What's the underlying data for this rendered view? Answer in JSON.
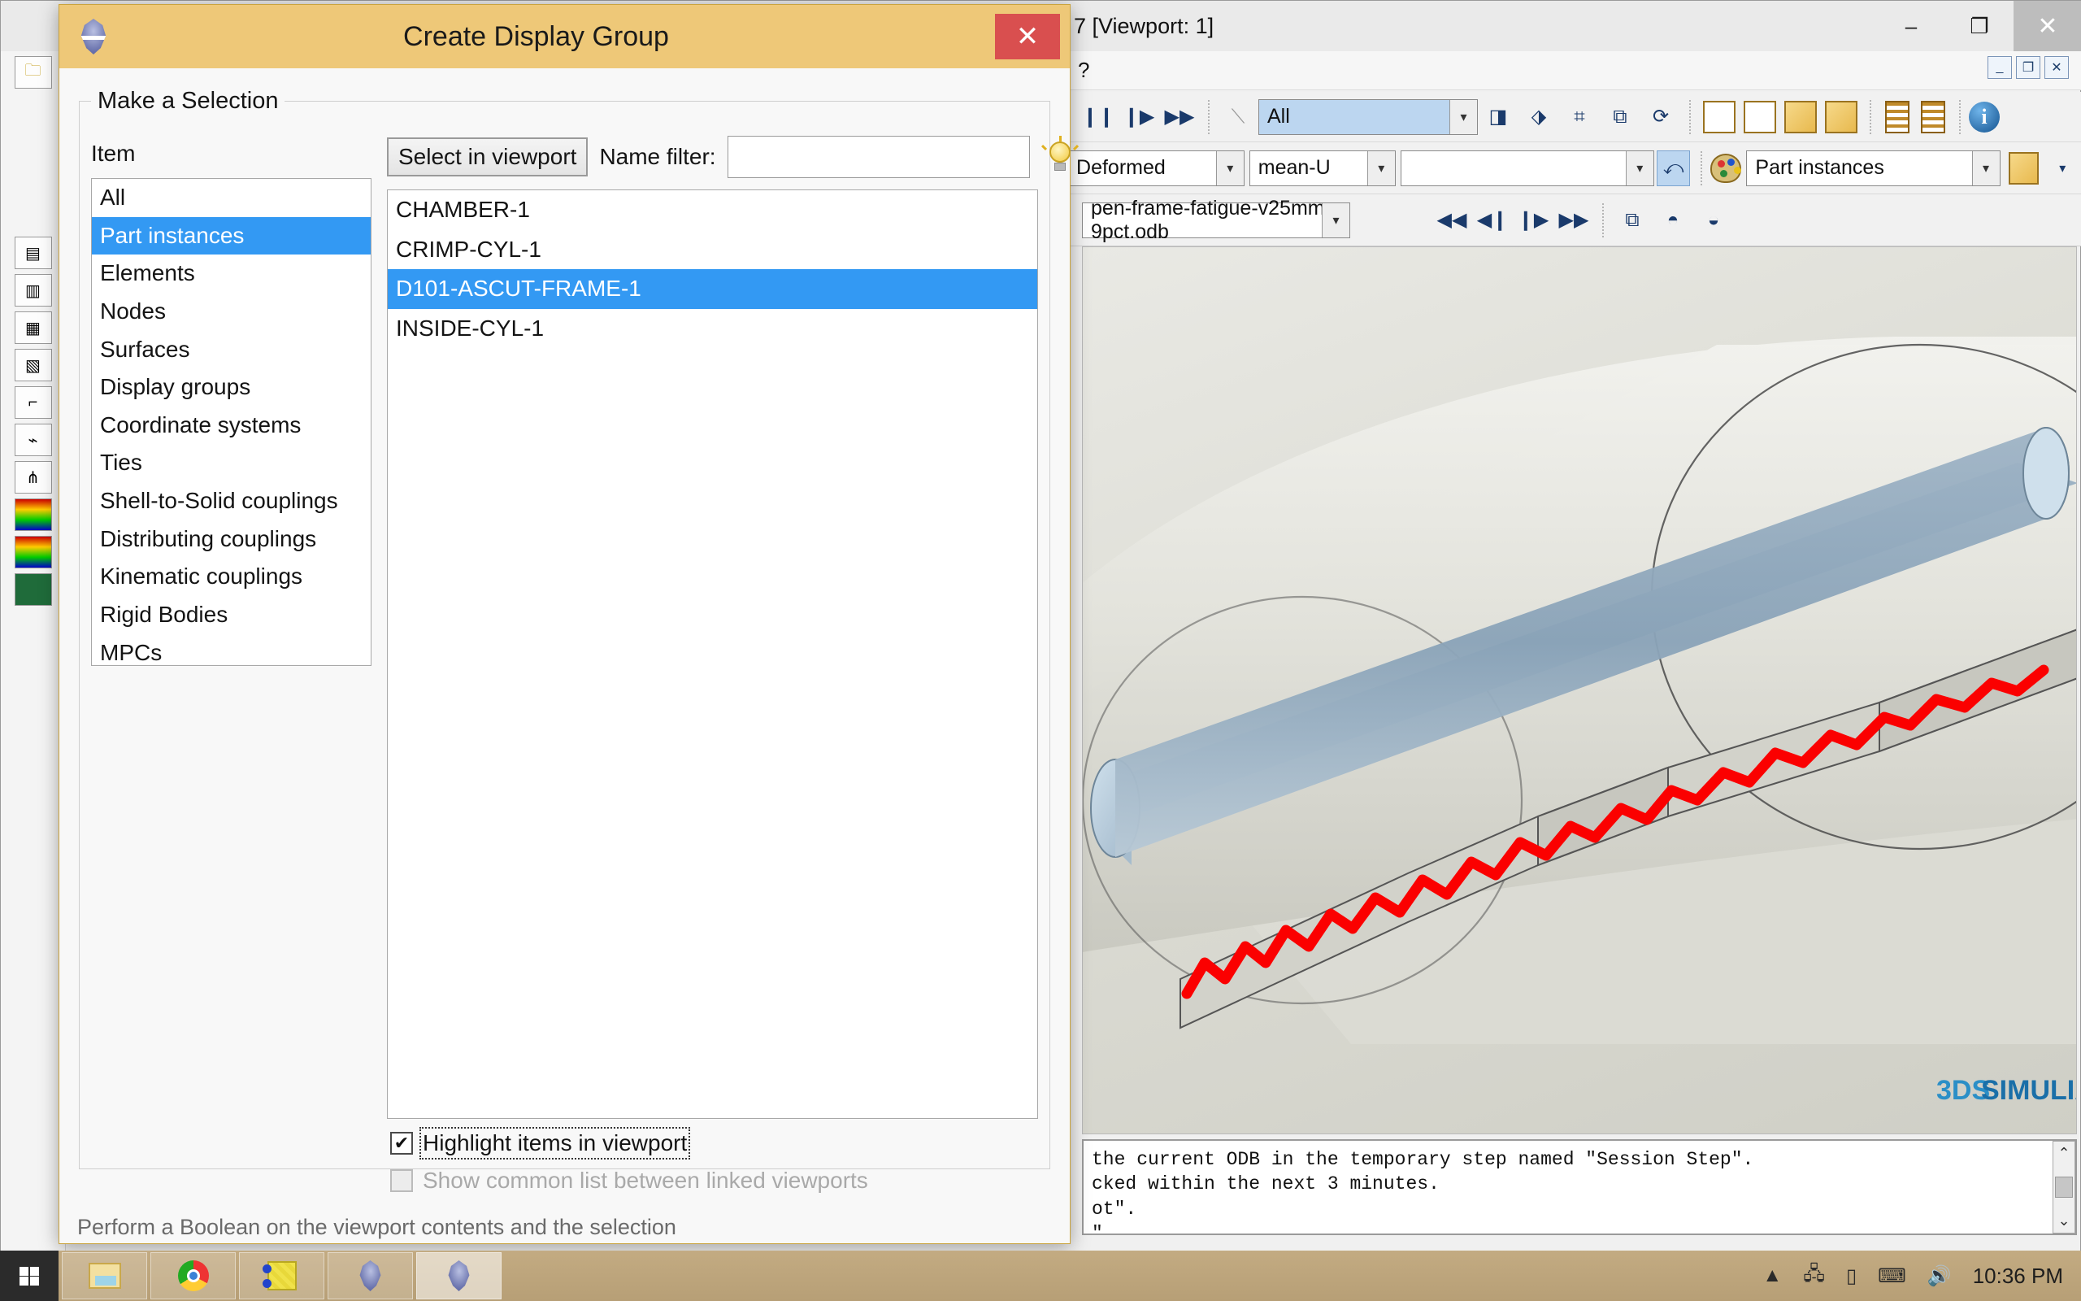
{
  "window": {
    "title": "7 [Viewport: 1]",
    "minimize_label": "–",
    "restore_label": "❐",
    "close_label": "✕",
    "menu_help": "?",
    "mdi_minimize": "_",
    "mdi_restore": "❐",
    "mdi_close": "✕"
  },
  "toolbar": {
    "selection_combo": "All",
    "plot_state_combo": "Deformed",
    "field_output_combo": "mean-U",
    "empty_combo": "",
    "display_group_combo": "Part instances",
    "odb_file": "pen-frame-fatigue-v25mm-9pct.odb",
    "icons": {
      "pause": "pause-icon",
      "step_forward": "step-forward-icon",
      "last_frame": "last-frame-icon",
      "arrow_select": "arrow-select-icon",
      "first_frame": "first-frame-icon",
      "prev_frame": "previous-frame-icon",
      "next_frame": "next-frame-icon",
      "end_frame": "end-frame-icon",
      "refresh": "refresh-icon",
      "palette": "color-palette-icon",
      "info": "info-icon",
      "camera": "camera-icon"
    }
  },
  "dialog": {
    "title": "Create Display Group",
    "close_label": "✕",
    "group_legend": "Make a Selection",
    "item_label": "Item",
    "items": [
      "All",
      "Part instances",
      "Elements",
      "Nodes",
      "Surfaces",
      "Display groups",
      "Coordinate systems",
      "Ties",
      "Shell-to-Solid couplings",
      "Distributing couplings",
      "Kinematic couplings",
      "Rigid Bodies",
      "MPCs"
    ],
    "selected_item": "Part instances",
    "select_in_viewport_button": "Select in viewport",
    "name_filter_label": "Name filter:",
    "name_filter_value": "",
    "name_filter_placeholder": "",
    "bulb_icon": "lightbulb-icon",
    "instances": [
      "CHAMBER-1",
      "CRIMP-CYL-1",
      "D101-ASCUT-FRAME-1",
      "INSIDE-CYL-1"
    ],
    "selected_instance": "D101-ASCUT-FRAME-1",
    "highlight_checkbox_label": "Highlight items in viewport",
    "highlight_checkbox_checked": true,
    "highlight_checkbox_mark": "✔",
    "common_list_checkbox_label": "Show common list between linked viewports",
    "common_list_checkbox_checked": false,
    "common_list_checkbox_disabled": true,
    "status_text": "Perform a Boolean on the viewport contents and the selection"
  },
  "viewport": {
    "branding": "SIMULIA",
    "branding_prefix": "3DS"
  },
  "console": {
    "lines": [
      "the current ODB in the temporary step named \"Session Step\".",
      "cked within the next 3 minutes.",
      "ot\".",
      "\".",
      "."
    ],
    "scroll_up": "⌃",
    "scroll_down": "⌄"
  },
  "taskbar": {
    "start_label": "start-button",
    "items": [
      "file-explorer-icon",
      "chrome-icon",
      "notes-icon",
      "abaqus-icon",
      "abaqus-active-icon"
    ],
    "tray": [
      "show-hidden-icon",
      "network-icon",
      "battery-icon",
      "keyboard-icon",
      "volume-icon"
    ],
    "clock": "10:36 PM"
  },
  "colors": {
    "dialog_title_bg": "#eec878",
    "selection_blue": "#3399f3",
    "close_red": "#d94f4f",
    "accent_red_path": "#fb0000",
    "simulia_blue": "#2b8fc7"
  }
}
